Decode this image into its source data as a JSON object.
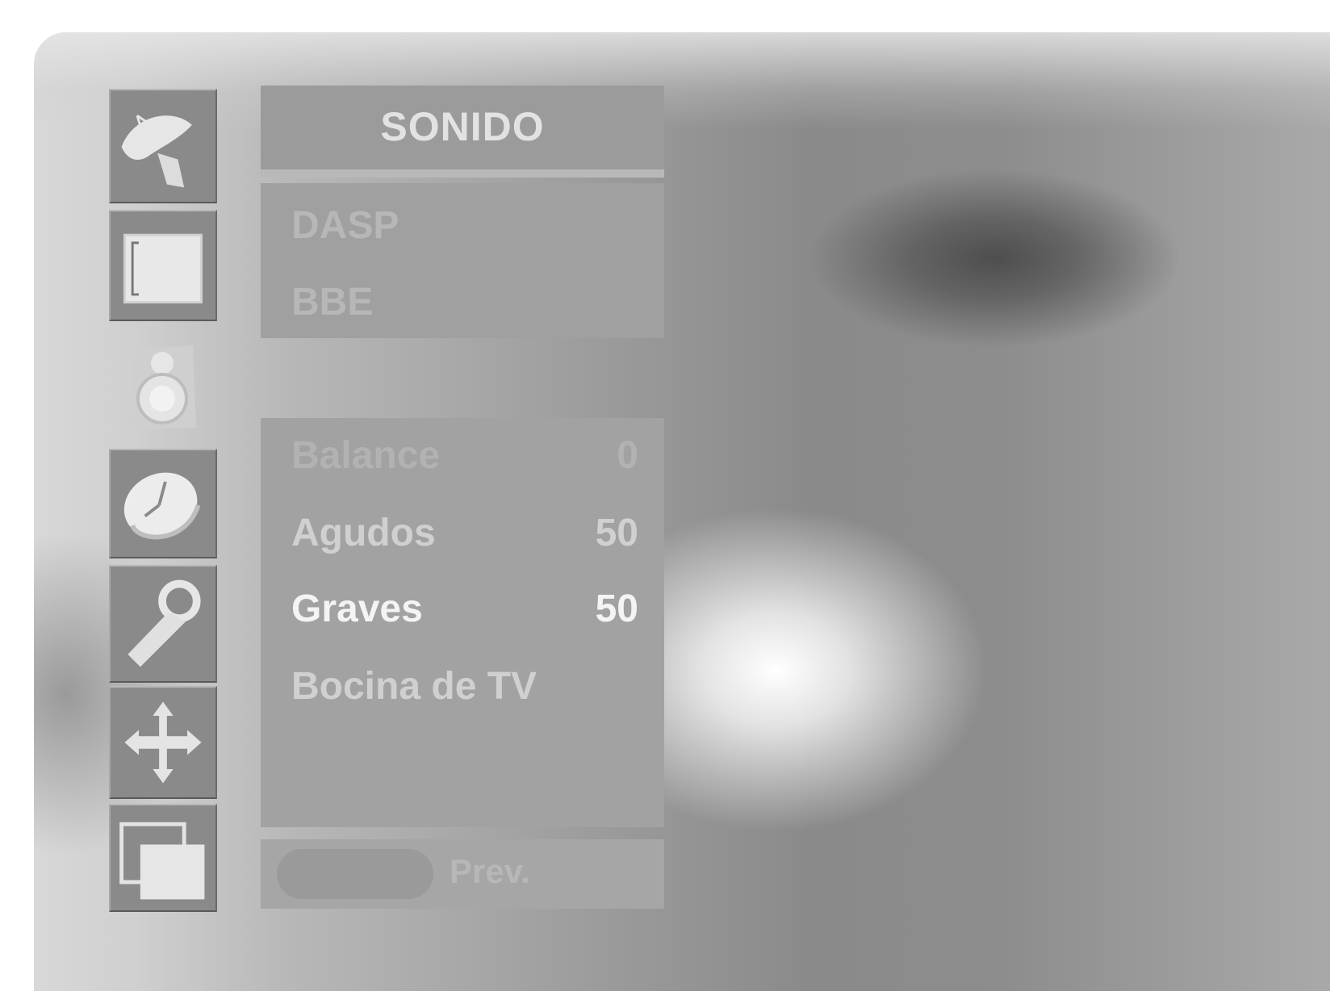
{
  "menu": {
    "title": "SONIDO",
    "sidebar_icons": [
      "satellite-dish-icon",
      "picture-screen-icon",
      "speaker-icon",
      "clock-icon",
      "wrench-icon",
      "move-arrows-icon",
      "multi-window-icon"
    ],
    "active_icon": "speaker-icon",
    "top_items": [
      {
        "label": "DASP"
      },
      {
        "label": "BBE"
      }
    ],
    "bottom_items": [
      {
        "label": "Balance",
        "value": "0"
      },
      {
        "label": "Agudos",
        "value": "50"
      },
      {
        "label": "Graves",
        "value": "50",
        "selected": true
      },
      {
        "label": "Bocina de TV"
      }
    ],
    "footer": {
      "prev_label": "Prev."
    }
  }
}
